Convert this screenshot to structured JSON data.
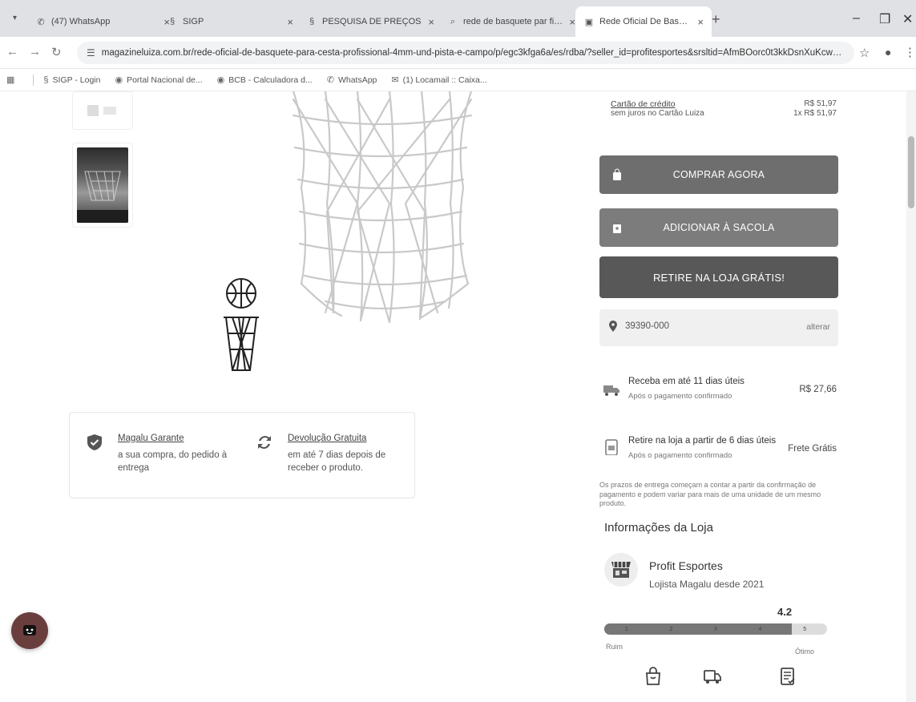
{
  "browser": {
    "tabs": [
      {
        "title": "(47) WhatsApp",
        "icon": "whatsapp-icon"
      },
      {
        "title": "SIGP",
        "icon": "sigp-icon"
      },
      {
        "title": "PESQUISA DE PREÇOS",
        "icon": "sigp-icon"
      },
      {
        "title": "rede de basquete par fio 4mm",
        "icon": "search-icon"
      },
      {
        "title": "Rede Oficial De Basquete Para C",
        "icon": "magalu-icon"
      }
    ],
    "url": "magazineluiza.com.br/rede-oficial-de-basquete-para-cesta-profissional-4mm-und-pista-e-campo/p/egc3kfga6a/es/rdba/?seller_id=profitesportes&srsltid=AfmBOorc0t3kkDsnXuKcwvnrp3MvUB_A0egNFFLPO5B...",
    "bookmarks": [
      {
        "label": "SIGP - Login",
        "icon": "sigp-icon"
      },
      {
        "label": "Portal Nacional de...",
        "icon": "globe-icon"
      },
      {
        "label": "BCB - Calculadora d...",
        "icon": "globe-icon"
      },
      {
        "label": "WhatsApp",
        "icon": "whatsapp-icon"
      },
      {
        "label": "(1) Locamail :: Caixa...",
        "icon": "mail-icon"
      }
    ]
  },
  "payment": {
    "credit_label": "Cartão de crédito",
    "credit_sub": "sem juros no Cartão Luiza",
    "credit_value": "R$ 51,97",
    "credit_value2": "1x R$ 51,97"
  },
  "buttons": {
    "buy_now": "COMPRAR AGORA",
    "add_bag": "ADICIONAR À SACOLA",
    "pickup": "RETIRE NA LOJA GRÁTIS!"
  },
  "cep": {
    "value": "39390-000",
    "change": "alterar"
  },
  "shipping": [
    {
      "title": "Receba em até 11 dias úteis",
      "sub": "Após o pagamento confirmado",
      "price": "R$ 27,66",
      "icon": "truck-icon"
    },
    {
      "title": "Retire na loja a partir de 6 dias úteis",
      "sub": "Após o pagamento confirmado",
      "price": "Frete Grátis",
      "icon": "store-pickup-icon"
    }
  ],
  "notice": "Os prazos de entrega começam a contar a partir da confirmação de pagamento e podem variar para mais de uma unidade de um mesmo produto.",
  "guarantee": [
    {
      "title": "Magalu Garante",
      "desc": "a sua compra, do pedido à entrega",
      "icon": "shield-check-icon"
    },
    {
      "title": "Devolução Gratuita",
      "desc": "em até 7 dias depois de receber o produto.",
      "icon": "refresh-icon"
    }
  ],
  "store": {
    "section_title": "Informações da Loja",
    "name": "Profit Esportes",
    "since": "Lojista Magalu desde 2021",
    "rating": "4.2",
    "rating_fraction": 0.84,
    "scale_ticks": [
      "1",
      "2",
      "3",
      "4",
      "5"
    ],
    "scale_low": "Ruim",
    "scale_high": "Ótimo"
  }
}
